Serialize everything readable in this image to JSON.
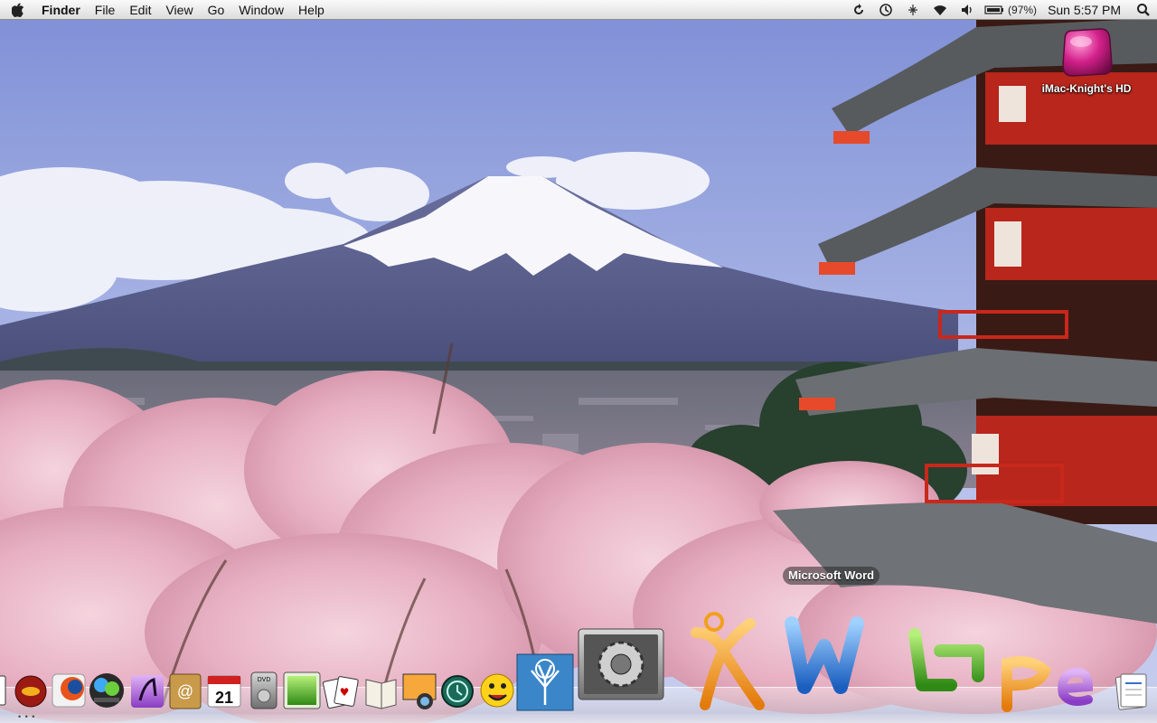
{
  "menubar": {
    "apple_icon": "apple-logo-icon",
    "app_name": "Finder",
    "menus": [
      "File",
      "Edit",
      "View",
      "Go",
      "Window",
      "Help"
    ],
    "status_icons": [
      "sync-icon",
      "time-machine-icon",
      "bluetooth-icon",
      "wifi-icon",
      "volume-icon",
      "battery-icon"
    ],
    "battery_percent": "(97%)",
    "clock": "Sun 5:57 PM",
    "spotlight_icon": "spotlight-search-icon"
  },
  "desktop": {
    "hard_drive_label": "iMac-Knight's HD",
    "hard_drive_icon": "hard-drive-icon"
  },
  "dock": {
    "tooltip": "Microsoft Word",
    "calendar_day": "21",
    "dvd_label": "DVD",
    "icons": [
      "finder-icon",
      "safari-icon",
      "firefox-icon",
      "messenger-icon",
      "itunes-icon",
      "address-book-icon",
      "ical-icon",
      "dvd-player-icon",
      "preview-icon",
      "solitaire-icon",
      "dictionary-icon",
      "iphoto-icon",
      "time-machine-icon",
      "yahoo-messenger-icon",
      "tree-app-icon",
      "system-preferences-icon",
      "microsoft-excel-icon",
      "microsoft-word-icon",
      "microsoft-entourage-icon",
      "microsoft-powerpoint-icon",
      "microsoft-expression-icon",
      "documents-stack-icon"
    ]
  }
}
